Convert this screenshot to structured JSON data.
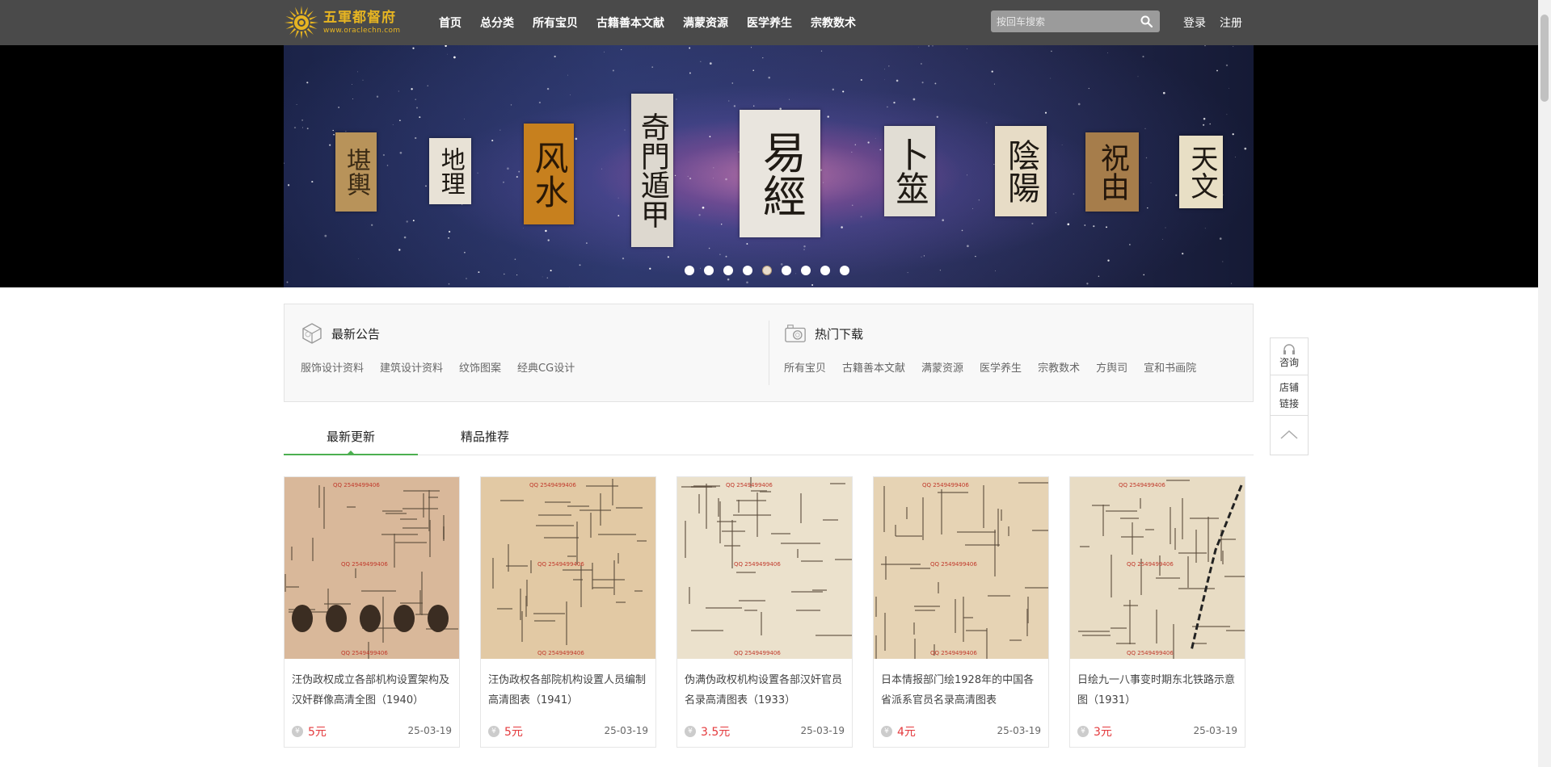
{
  "header": {
    "logo": {
      "title": "五軍都督府",
      "url": "www.oraclechn.com"
    },
    "nav": [
      "首页",
      "总分类",
      "所有宝贝",
      "古籍善本文献",
      "满蒙资源",
      "医学养生",
      "宗教数术"
    ],
    "search": {
      "placeholder": "按回车搜索"
    },
    "auth": {
      "login": "登录",
      "register": "注册"
    }
  },
  "banner": {
    "tiles": [
      "堪輿",
      "地理",
      "风水",
      "奇門遁甲",
      "易經",
      "卜筮",
      "陰陽",
      "祝由",
      "天文"
    ],
    "dot_count": 9,
    "active_dot": 4
  },
  "notice": {
    "latest": {
      "title": "最新公告",
      "links": [
        "服饰设计资料",
        "建筑设计资料",
        "纹饰图案",
        "经典CG设计"
      ]
    },
    "hot": {
      "title": "热门下载",
      "links": [
        "所有宝贝",
        "古籍善本文献",
        "满蒙资源",
        "医学养生",
        "宗教数术",
        "方舆司",
        "宣和书画院"
      ]
    }
  },
  "sidetool": {
    "consult": "咨询",
    "shop_link_1": "店铺",
    "shop_link_2": "链接"
  },
  "tabs": [
    "最新更新",
    "精品推荐"
  ],
  "products": [
    {
      "title": "汪伪政权成立各部机构设置架构及汉奸群像高清全图（1940）",
      "price": "5元",
      "date": "25-03-19",
      "tone": "#d9b89a"
    },
    {
      "title": "汪伪政权各部院机构设置人员编制高清图表（1941）",
      "price": "5元",
      "date": "25-03-19",
      "tone": "#e2c9a4"
    },
    {
      "title": "伪满伪政权机构设置各部汉奸官员名录高清图表（1933）",
      "price": "3.5元",
      "date": "25-03-19",
      "tone": "#ebe1cc"
    },
    {
      "title": "日本情报部门绘1928年的中国各省派系官员名录高清图表",
      "price": "4元",
      "date": "25-03-19",
      "tone": "#e6d3b4"
    },
    {
      "title": "日绘九一八事变时期东北铁路示意图（1931）",
      "price": "3元",
      "date": "25-03-19",
      "tone": "#e8dcc4"
    }
  ],
  "watermark": "QQ 2549499406",
  "colors": {
    "header_bg": "#4a4a4a",
    "accent_green": "#4caf50",
    "price_red": "#e4393c",
    "logo_gold": "#e6b422"
  }
}
